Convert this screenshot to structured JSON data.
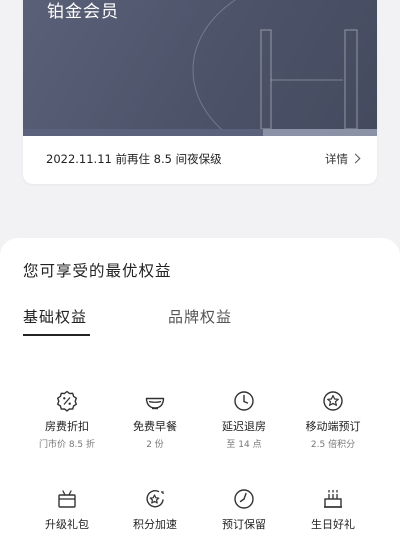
{
  "membership": {
    "tier": "铂金会员",
    "notice": "2022.11.11 前再住 8.5 间夜保级",
    "detail_label": "详情"
  },
  "benefits_panel": {
    "title": "您可享受的最优权益",
    "tabs": [
      {
        "label": "基础权益",
        "active": true
      },
      {
        "label": "品牌权益",
        "active": false
      }
    ],
    "items": [
      {
        "icon": "discount-badge-icon",
        "label": "房费折扣",
        "sub": "门市价 8.5 折"
      },
      {
        "icon": "breakfast-bowl-icon",
        "label": "免费早餐",
        "sub": "2 份"
      },
      {
        "icon": "clock-icon",
        "label": "延迟退房",
        "sub": "至 14 点"
      },
      {
        "icon": "star-circle-icon",
        "label": "移动端预订",
        "sub": "2.5 倍积分"
      },
      {
        "icon": "gift-box-icon",
        "label": "升级礼包",
        "sub": ""
      },
      {
        "icon": "star-speed-icon",
        "label": "积分加速",
        "sub": ""
      },
      {
        "icon": "reservation-clock-icon",
        "label": "预订保留",
        "sub": ""
      },
      {
        "icon": "birthday-cake-icon",
        "label": "生日好礼",
        "sub": ""
      }
    ]
  },
  "colors": {
    "hero": "#4f566c",
    "accent_bar": "#8b91a6"
  }
}
